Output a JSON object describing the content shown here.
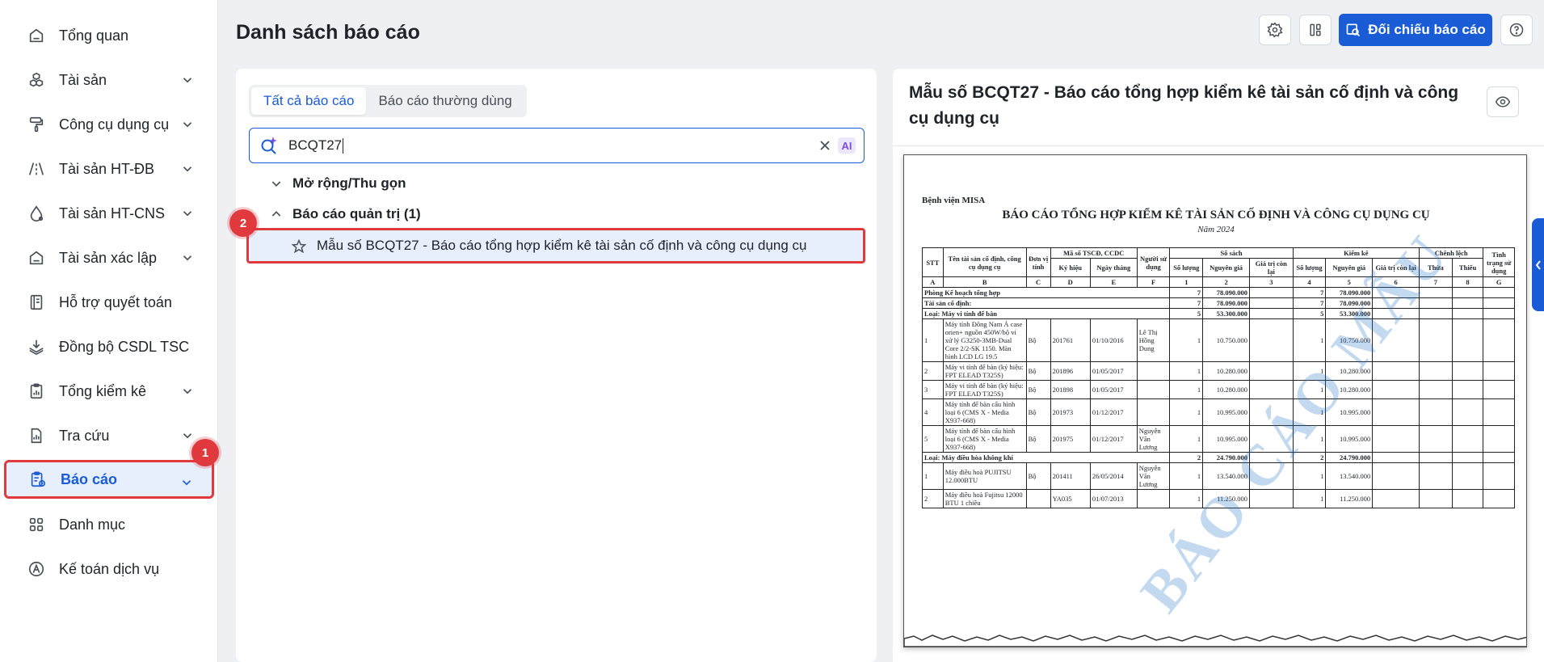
{
  "sidebar": {
    "items": [
      {
        "label": "Tổng quan",
        "icon": "home-icon",
        "has_chevron": false
      },
      {
        "label": "Tài sản",
        "icon": "cubes-icon",
        "has_chevron": true
      },
      {
        "label": "Công cụ dụng cụ",
        "icon": "paint-roller-icon",
        "has_chevron": true
      },
      {
        "label": "Tài sản HT-ĐB",
        "icon": "road-icon",
        "has_chevron": true
      },
      {
        "label": "Tài sản HT-CNS",
        "icon": "water-drop-icon",
        "has_chevron": true
      },
      {
        "label": "Tài sản xác lập",
        "icon": "house-icon",
        "has_chevron": true
      },
      {
        "label": "Hỗ trợ quyết toán",
        "icon": "book-icon",
        "has_chevron": false
      },
      {
        "label": "Đồng bộ CSDL TSC",
        "icon": "layers-icon",
        "has_chevron": false
      },
      {
        "label": "Tổng kiểm kê",
        "icon": "clipboard-chart-icon",
        "has_chevron": true
      },
      {
        "label": "Tra cứu",
        "icon": "doc-chart-icon",
        "has_chevron": true
      },
      {
        "label": "Báo cáo",
        "icon": "report-clipboard-icon",
        "has_chevron": true,
        "active": true
      },
      {
        "label": "Danh mục",
        "icon": "grid-icon",
        "has_chevron": false
      },
      {
        "label": "Kế toán dịch vụ",
        "icon": "accounting-icon",
        "has_chevron": false
      }
    ]
  },
  "annotations": {
    "badge1": "1",
    "badge2": "2"
  },
  "header": {
    "title": "Danh sách báo cáo",
    "compare_button": "Đối chiếu báo cáo"
  },
  "left_panel": {
    "tabs": [
      "Tất cả báo cáo",
      "Báo cáo thường dùng"
    ],
    "search": {
      "value": "BCQT27"
    },
    "ai_label": "AI",
    "expand_collapse": "Mở rộng/Thu gọn",
    "group": "Báo cáo quản trị (1)",
    "report_item": "Mẫu số BCQT27 - Báo cáo tổng hợp kiểm kê tài sản cố định và công cụ dụng cụ"
  },
  "preview": {
    "title": "Mẫu số BCQT27 - Báo cáo tổng hợp kiểm kê tài sản cố định và công cụ dụng cụ",
    "org": "Bệnh viện MISA",
    "doc_title": "BÁO CÁO TỔNG HỢP KIỂM KÊ TÀI SẢN CỐ ĐỊNH VÀ CÔNG CỤ DỤNG CỤ",
    "year": "Năm 2024",
    "watermark": "BÁO CÁO MẪU",
    "table": {
      "h_stt": "STT",
      "h_name": "Tên tài sản cố định, công cụ dụng cụ",
      "h_unit": "Đơn vị tính",
      "h_code": "Mã số TSCĐ, CCDC",
      "h_symbol": "Ký hiệu",
      "h_date": "Ngày tháng",
      "h_user": "Người sử dụng",
      "h_books": "Số sách",
      "h_check": "Kiểm kê",
      "h_diff": "Chênh lệch",
      "h_status": "Tình trạng sử dụng",
      "h_qty": "Số lượng",
      "h_cost": "Nguyên giá",
      "h_remain": "Giá trị còn lại",
      "h_surplus": "Thừa",
      "h_short": "Thiếu",
      "letters": [
        "A",
        "B",
        "C",
        "D",
        "E",
        "F",
        "1",
        "2",
        "3",
        "4",
        "5",
        "6",
        "7",
        "8",
        "G"
      ],
      "groups": [
        {
          "label": "Phòng Kế hoạch tổng hợp",
          "qty": "7",
          "cost": "78.090.000",
          "qty2": "7",
          "cost2": "78.090.000"
        },
        {
          "label": "Tài sản cố định:",
          "qty": "7",
          "cost": "78.090.000",
          "qty2": "7",
          "cost2": "78.090.000"
        },
        {
          "label": "Loại: Máy vi tính để bàn",
          "qty": "5",
          "cost": "53.300.000",
          "qty2": "5",
          "cost2": "53.300.000"
        }
      ],
      "rows1": [
        {
          "stt": "1",
          "name": "Máy tính Đông Nam Á case orien+ nguồn 450W/bộ vi xử lý G3250-3MB-Dual Core 2/2-SK 1150. Màn hình LCD LG 19.5",
          "unit": "Bộ",
          "code": "201761",
          "date": "01/10/2016",
          "user": "Lê Thị Hồng Dung",
          "qty": "1",
          "cost": "10.750.000",
          "qty2": "1",
          "cost2": "10.750.000"
        },
        {
          "stt": "2",
          "name": "Máy vi tính để bàn (ký hiệu: FPT ELEAD T325S)",
          "unit": "Bộ",
          "code": "201896",
          "date": "01/05/2017",
          "user": "",
          "qty": "1",
          "cost": "10.280.000",
          "qty2": "1",
          "cost2": "10.280.000"
        },
        {
          "stt": "3",
          "name": "Máy vi tính để bàn (ký hiệu: FPT ELEAD T325S)",
          "unit": "Bộ",
          "code": "201898",
          "date": "01/05/2017",
          "user": "",
          "qty": "1",
          "cost": "10.280.000",
          "qty2": "1",
          "cost2": "10.280.000"
        },
        {
          "stt": "4",
          "name": "Máy tính để bàn cấu hình loại 6 (CMS X - Media X937-668)",
          "unit": "Bộ",
          "code": "201973",
          "date": "01/12/2017",
          "user": "",
          "qty": "1",
          "cost": "10.995.000",
          "qty2": "1",
          "cost2": "10.995.000"
        },
        {
          "stt": "5",
          "name": "Máy tính để bàn cấu hình loại 6 (CMS X - Media X937-668)",
          "unit": "Bộ",
          "code": "201975",
          "date": "01/12/2017",
          "user": "Nguyễn Văn Lương",
          "qty": "1",
          "cost": "10.995.000",
          "qty2": "1",
          "cost2": "10.995.000"
        }
      ],
      "group4": {
        "label": "Loại: Máy điều hòa không khí",
        "qty": "2",
        "cost": "24.790.000",
        "qty2": "2",
        "cost2": "24.790.000"
      },
      "rows2": [
        {
          "stt": "1",
          "name": "Máy điều hoà PUJITSU 12.000BTU",
          "unit": "Bộ",
          "code": "201411",
          "date": "26/05/2014",
          "user": "Nguyễn Văn Lương",
          "qty": "1",
          "cost": "13.540.000",
          "qty2": "1",
          "cost2": "13.540.000"
        },
        {
          "stt": "2",
          "name": "Máy điều hoà Fujitsu 12000 BTU 1 chiều",
          "unit": "",
          "code": "YA035",
          "date": "01/07/2013",
          "user": "",
          "qty": "1",
          "cost": "11.250.000",
          "qty2": "1",
          "cost2": "11.250.000"
        }
      ]
    }
  }
}
